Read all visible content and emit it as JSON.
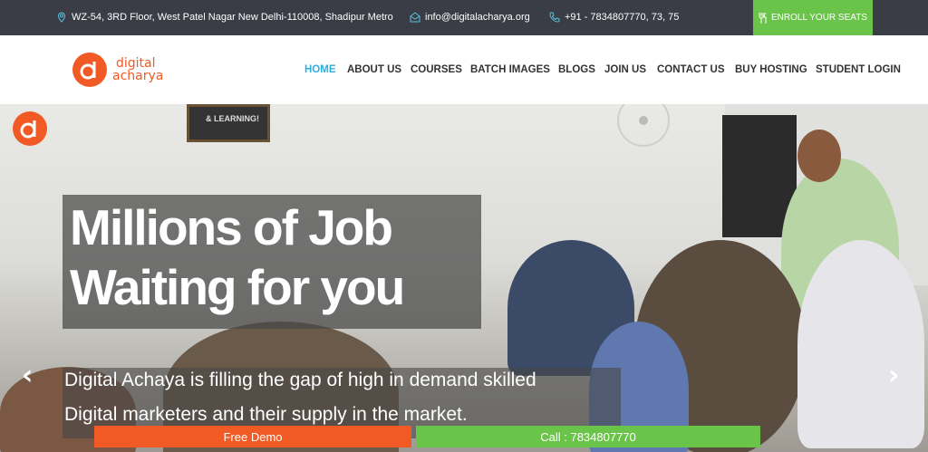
{
  "topbar": {
    "address": "WZ-54, 3RD Floor, West Patel Nagar New Delhi-110008, Shadipur Metro",
    "email": "info@digitalacharya.org",
    "phone": "+91 - 7834807770, 73, 75",
    "enroll_label": "ENROLL YOUR SEATS",
    "icons": [
      "location-icon",
      "mail-icon",
      "phone-icon",
      "cutlery-icon"
    ]
  },
  "logo": {
    "line1": "digital",
    "line2": "acharya"
  },
  "nav": [
    {
      "label": "HOME",
      "active": true
    },
    {
      "label": "ABOUT US"
    },
    {
      "label": "COURSES"
    },
    {
      "label": "BATCH IMAGES"
    },
    {
      "label": "BLOGS"
    },
    {
      "label": "JOIN US"
    },
    {
      "label": "CONTACT US"
    },
    {
      "label": "BUY HOSTING"
    },
    {
      "label": "STUDENT LOGIN"
    }
  ],
  "hero": {
    "headline_line1": "Millions of Job",
    "headline_line2": "Waiting for you",
    "sub_line1": "Digital Achaya is filling the gap of high in demand skilled",
    "sub_line2": "Digital marketers and their supply in the market.",
    "poster_text": "& LEARNING!",
    "prev_arrow": "‹",
    "next_arrow": "›"
  },
  "cta": {
    "demo_label": "Free Demo",
    "call_label": "Call : 7834807770"
  },
  "colors": {
    "accent_orange": "#f15a24",
    "accent_green": "#6bc44a",
    "topbar_bg": "#3a3d46",
    "nav_active": "#2ab0e0"
  }
}
